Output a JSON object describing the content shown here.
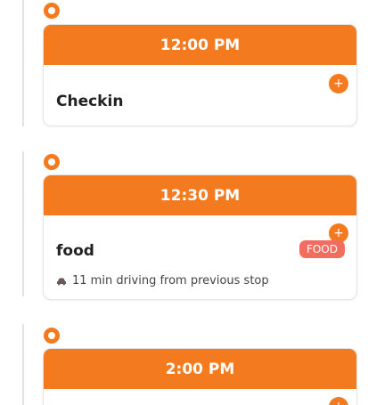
{
  "stops": [
    {
      "time": "12:00 PM",
      "name": "Checkin",
      "add_label": "+"
    },
    {
      "time": "12:30 PM",
      "name": "food",
      "add_label": "+",
      "category_tag": "FOOD",
      "travel_note": "11 min driving from previous stop",
      "travel_icon": "car-icon"
    },
    {
      "time": "2:00 PM",
      "add_label": "+"
    }
  ],
  "colors": {
    "accent": "#f47a1f",
    "tag": "#f36d5f",
    "rail": "#e3e3e3"
  }
}
